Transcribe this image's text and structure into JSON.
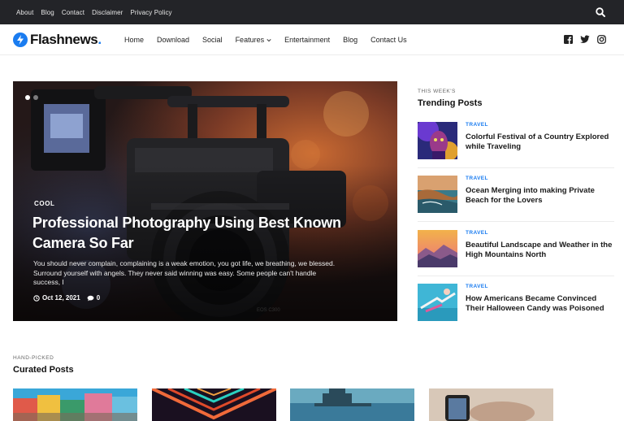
{
  "topbar": {
    "links": [
      "About",
      "Blog",
      "Contact",
      "Disclaimer",
      "Privacy Policy"
    ],
    "search_icon": "search-icon"
  },
  "header": {
    "logo_text": "Flashnews",
    "logo_dot": ".",
    "nav": [
      {
        "label": "Home"
      },
      {
        "label": "Download"
      },
      {
        "label": "Social"
      },
      {
        "label": "Features",
        "has_dropdown": true
      },
      {
        "label": "Entertainment"
      },
      {
        "label": "Blog"
      },
      {
        "label": "Contact Us"
      }
    ],
    "social_icons": [
      "facebook-icon",
      "twitter-icon",
      "instagram-icon"
    ]
  },
  "hero": {
    "category": "COOL",
    "title": "Professional Photography Using Best Known Camera So Far",
    "excerpt": "You should never complain, complaining is a weak emotion, you got life, we breathing, we blessed. Surround yourself with angels. They never said winning was easy. Some people can't handle success, I",
    "date": "Oct 12, 2021",
    "comments": "0",
    "slides": 2,
    "active_slide": 1
  },
  "trending": {
    "kicker": "THIS WEEK'S",
    "title": "Trending Posts",
    "items": [
      {
        "category": "TRAVEL",
        "title": "Colorful Festival of a Country Explored while Traveling"
      },
      {
        "category": "TRAVEL",
        "title": "Ocean Merging into making Private Beach for the Lovers"
      },
      {
        "category": "TRAVEL",
        "title": "Beautiful Landscape and Weather in the High Mountains North"
      },
      {
        "category": "TRAVEL",
        "title": "How Americans Became Convinced Their Halloween Candy was Poisoned"
      }
    ]
  },
  "curated": {
    "kicker": "HAND-PICKED",
    "title": "Curated Posts"
  },
  "colors": {
    "accent": "#1a7cf0",
    "topbar_bg": "#232428",
    "text": "#111111"
  }
}
